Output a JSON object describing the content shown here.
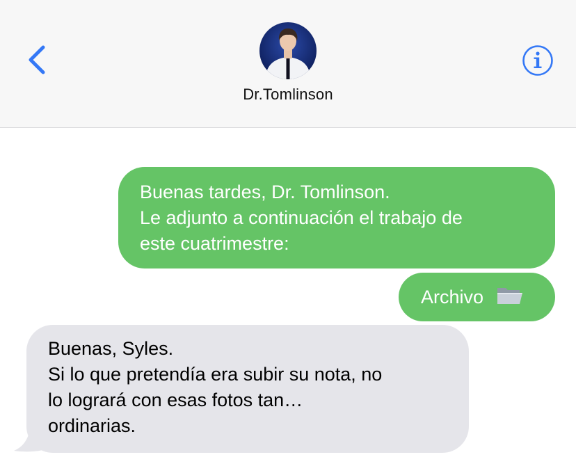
{
  "header": {
    "back_icon": "chevron-left-icon",
    "contact_name": "Dr.Tomlinson",
    "info_icon": "info-icon",
    "accent_color": "#3478f6"
  },
  "messages": [
    {
      "direction": "sent",
      "lines": [
        "Buenas tardes, Dr. Tomlinson.",
        "Le adjunto a continuación el trabajo de",
        "este cuatrimestre:"
      ]
    },
    {
      "direction": "sent",
      "text": "Archivo",
      "icon": "folder-icon"
    },
    {
      "direction": "received",
      "lines": [
        "Buenas, Syles.",
        "Si lo que pretendía era subir su nota, no",
        "lo logrará con esas fotos tan…",
        "ordinarias."
      ]
    }
  ],
  "colors": {
    "sent_bubble": "#65c466",
    "received_bubble": "#e5e5ea",
    "header_background": "#f7f7f7"
  }
}
